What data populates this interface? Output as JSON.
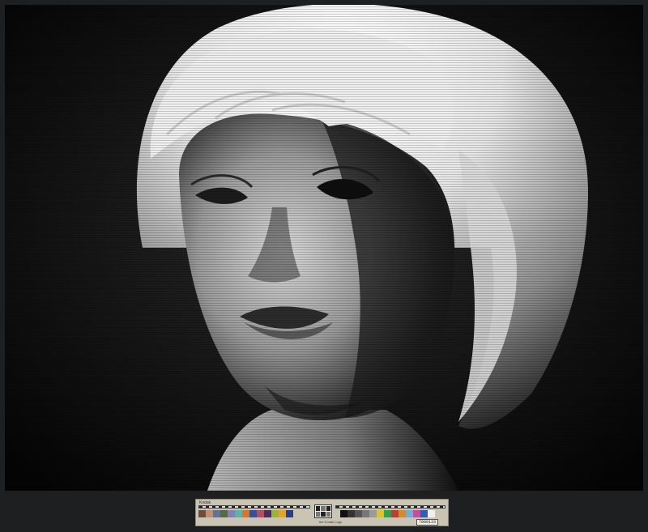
{
  "photo": {
    "subject": "portrait",
    "tone": "black-and-white",
    "colors": {
      "background": "#050505",
      "highlight": "#f2f2f2",
      "midtone": "#8a8a8a",
      "border": "#1e1f21"
    }
  },
  "color_target": {
    "brand": "Kodak",
    "caption": "the Kodak Logo",
    "id": "7000133",
    "patch_colors_left": [
      "#6e4d3a",
      "#c28f72",
      "#5f739c",
      "#566b3f",
      "#8a7fb0",
      "#5eb4a4",
      "#d9762a",
      "#3a4f98",
      "#b84d5d",
      "#4b2c5f",
      "#98b43c",
      "#e0a52b",
      "#2d3a8d"
    ],
    "gray_steps": [
      "#f3f3f3",
      "#cfcfcf",
      "#a9a9a9",
      "#858585",
      "#626262",
      "#3f3f3f",
      "#1f1f1f",
      "#0b0b0b"
    ],
    "patch_colors_right": [
      "#111111",
      "#333333",
      "#555555",
      "#777777",
      "#999999",
      "#e0c22b",
      "#3a9c4a",
      "#c23b3b",
      "#d18a2e",
      "#6bb0d8",
      "#c24f9c",
      "#2c5fb4",
      "#efefef"
    ]
  }
}
